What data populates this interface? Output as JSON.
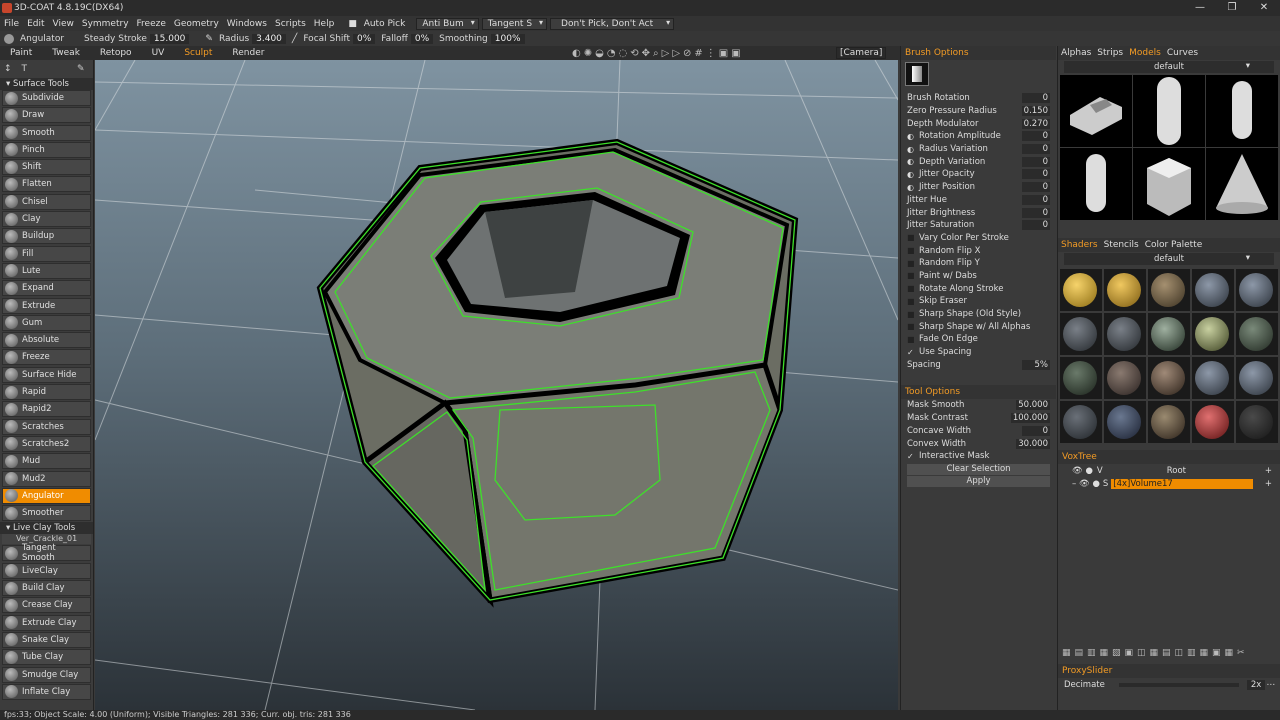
{
  "window": {
    "title": "3D-COAT 4.8.19C(DX64)",
    "controls": [
      "—",
      "❐",
      "✕"
    ]
  },
  "menu": {
    "items": [
      "File",
      "Edit",
      "View",
      "Symmetry",
      "Freeze",
      "Geometry",
      "Windows",
      "Scripts",
      "Help"
    ],
    "auto_pick": "Auto Pick",
    "anti_bump": "Anti Bum",
    "tangent": "Tangent S",
    "dont_pick": "Don't Pick, Don't Act"
  },
  "toolbar": {
    "tool_name": "Angulator",
    "steady_label": "Steady Stroke",
    "steady_value": "15.000",
    "radius_label": "Radius",
    "radius_value": "3.400",
    "focal_label": "Focal Shift",
    "focal_value": "0%",
    "falloff_label": "Falloff",
    "falloff_value": "0%",
    "smoothing_label": "Smoothing",
    "smoothing_value": "100%"
  },
  "rooms": {
    "items": [
      "Paint",
      "Tweak",
      "Retopo",
      "UV",
      "Sculpt",
      "Render"
    ],
    "active": "Sculpt",
    "camera": "[Camera]"
  },
  "left": {
    "surface_header": "Surface Tools",
    "surface_tools": [
      "Subdivide",
      "Draw",
      "Smooth",
      "Pinch",
      "Shift",
      "Flatten",
      "Chisel",
      "Clay",
      "Buildup",
      "Fill",
      "Lute",
      "Expand",
      "Extrude",
      "Gum",
      "Absolute",
      "Freeze",
      "Surface Hide",
      "Rapid",
      "Rapid2",
      "Scratches",
      "Scratches2",
      "Mud",
      "Mud2",
      "Angulator",
      "Smoother"
    ],
    "active_tool": "Angulator",
    "live_header": "Live Clay Tools",
    "live_sub": "Ver_Crackle_01",
    "live_tools": [
      "Tangent Smooth",
      "LiveClay",
      "Build Clay",
      "Crease Clay",
      "Extrude Clay",
      "Snake Clay",
      "Tube Clay",
      "Smudge Clay",
      "Inflate Clay"
    ]
  },
  "brush": {
    "header": "Brush Options",
    "params": [
      {
        "label": "Brush Rotation",
        "value": "0"
      },
      {
        "label": "Zero Pressure Radius",
        "value": "0.150"
      },
      {
        "label": "Depth Modulator",
        "value": "0.270"
      },
      {
        "label": "Rotation Amplitude",
        "value": "0"
      },
      {
        "label": "Radius Variation",
        "value": "0"
      },
      {
        "label": "Depth Variation",
        "value": "0"
      },
      {
        "label": "Jitter Opacity",
        "value": "0"
      },
      {
        "label": "Jitter Position",
        "value": "0"
      },
      {
        "label": "Jitter Hue",
        "value": "0"
      },
      {
        "label": "Jitter Brightness",
        "value": "0"
      },
      {
        "label": "Jitter Saturation",
        "value": "0"
      }
    ],
    "checks": [
      {
        "label": "Vary Color Per Stroke",
        "checked": false
      },
      {
        "label": "Random Flip X",
        "checked": false
      },
      {
        "label": "Random Flip Y",
        "checked": false
      },
      {
        "label": "Paint w/ Dabs",
        "checked": false
      },
      {
        "label": "Rotate Along Stroke",
        "checked": false
      },
      {
        "label": "Skip Eraser",
        "checked": false
      },
      {
        "label": "Sharp Shape (Old Style)",
        "checked": false
      },
      {
        "label": "Sharp Shape w/ All Alphas",
        "checked": false
      },
      {
        "label": "Fade On Edge",
        "checked": false
      },
      {
        "label": "Use Spacing",
        "checked": true
      }
    ],
    "spacing_label": "Spacing",
    "spacing_value": "5%"
  },
  "tool_options": {
    "header": "Tool Options",
    "params": [
      {
        "label": "Mask Smooth",
        "value": "50.000"
      },
      {
        "label": "Mask Contrast",
        "value": "100.000"
      },
      {
        "label": "Concave Width",
        "value": "0"
      },
      {
        "label": "Convex Width",
        "value": "30.000"
      }
    ],
    "interactive_mask": "Interactive Mask",
    "clear_selection": "Clear Selection",
    "apply": "Apply"
  },
  "models_panel": {
    "tabs": [
      "Alphas",
      "Strips",
      "Models",
      "Curves"
    ],
    "active": "Models",
    "preset": "default"
  },
  "shaders_panel": {
    "tabs": [
      "Shaders",
      "Stencils",
      "Color Palette"
    ],
    "active": "Shaders",
    "preset": "default"
  },
  "voxtree": {
    "header": "VoxTree",
    "root": "Root",
    "root_flag": "V",
    "volume": "[4x]Volume17",
    "volume_flag": "S"
  },
  "proxy": {
    "header": "ProxySlider",
    "decimate_label": "Decimate",
    "decimate_value": "2x"
  },
  "status": {
    "text": "fps:33;    Object Scale: 4.00 (Uniform); Visible Triangles: 281 336; Curr. obj. tris: 281 336"
  },
  "colors": {
    "accent": "#f29b25",
    "active_tool": "#f08c00",
    "outline": "#3ee02a"
  }
}
